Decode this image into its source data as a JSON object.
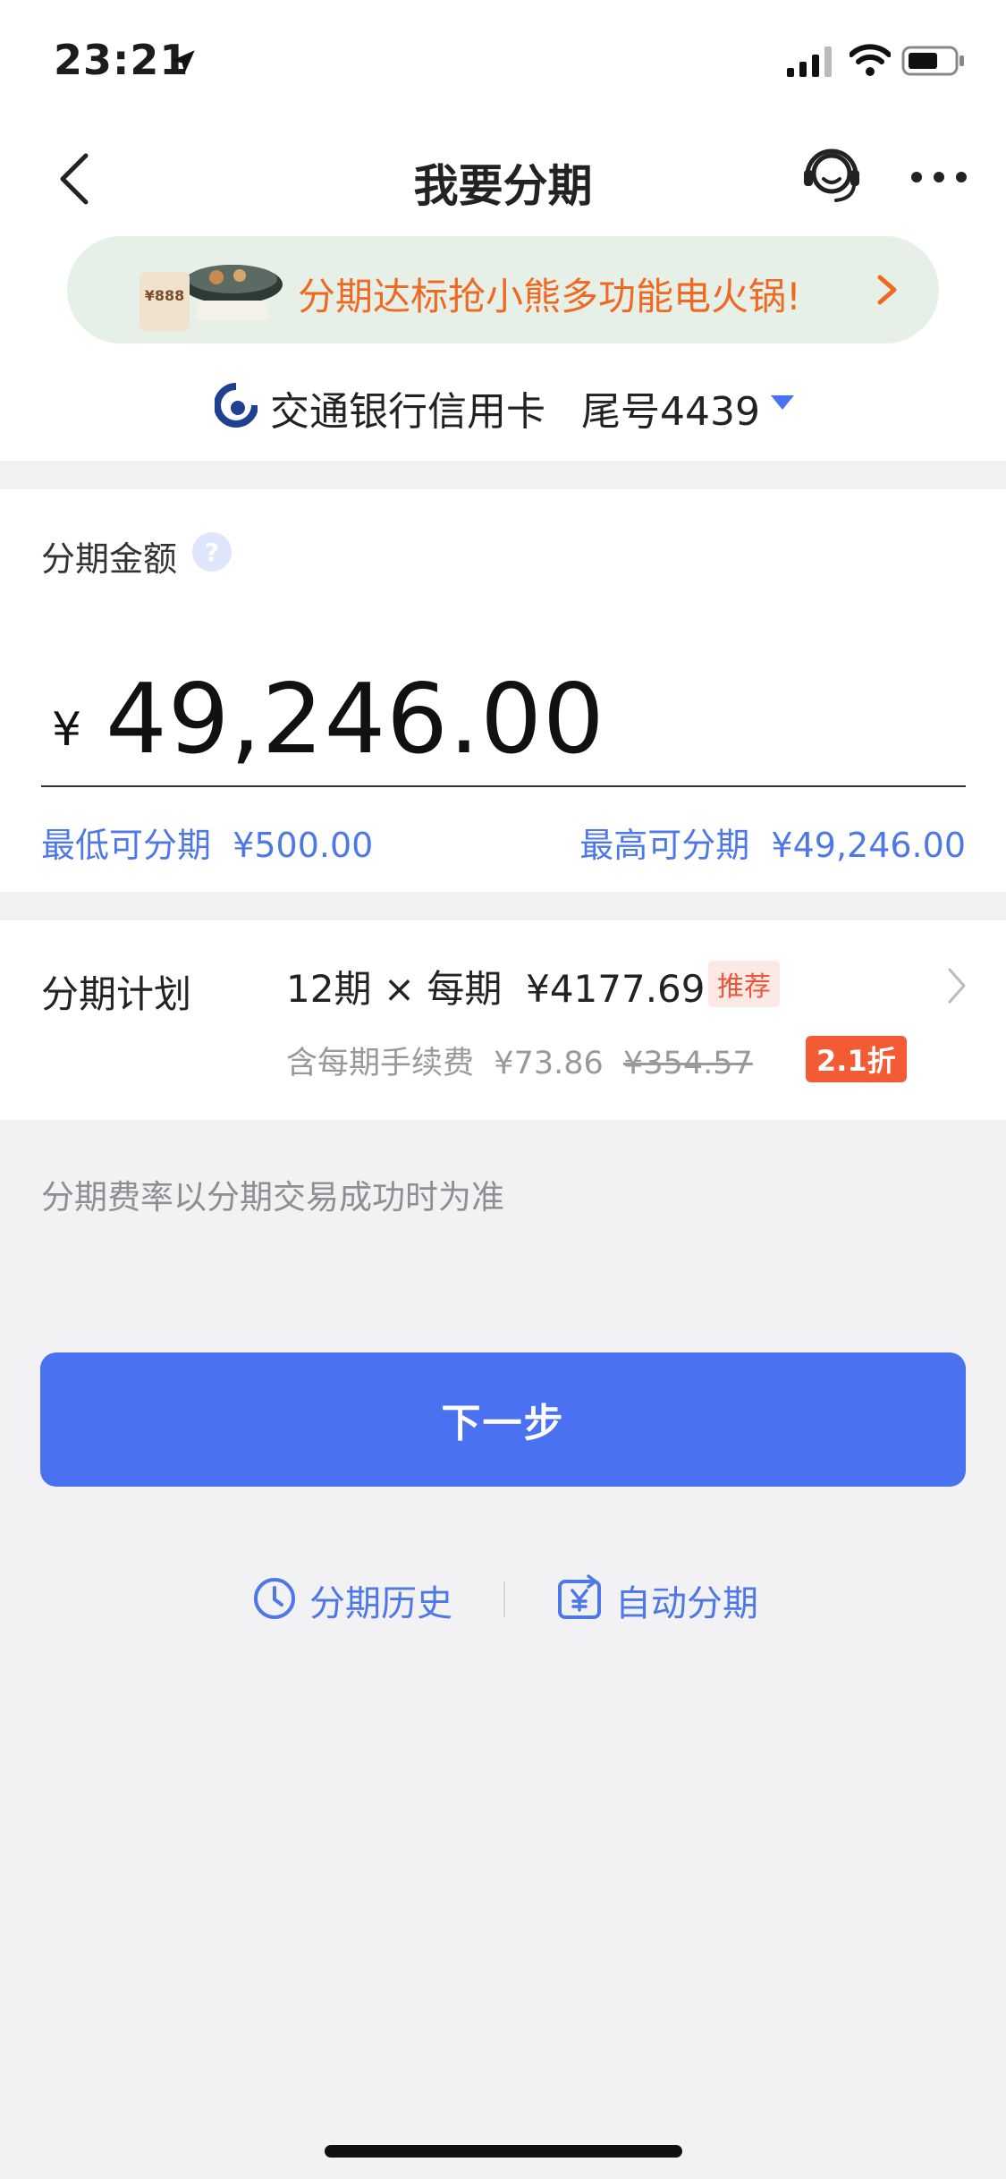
{
  "status_bar": {
    "time": "23:21",
    "icons": [
      "location-arrow-icon",
      "signal-icon",
      "wifi-icon",
      "battery-icon"
    ]
  },
  "nav": {
    "title": "我要分期",
    "icons": [
      "back-icon",
      "customer-service-icon",
      "more-icon"
    ]
  },
  "banner": {
    "text": "分期达标抢小熊多功能电火锅!",
    "image_tag": "¥888"
  },
  "card": {
    "bank_name": "交通银行信用卡",
    "tail": "尾号4439"
  },
  "amount": {
    "label": "分期金额",
    "currency": "¥",
    "value": "49,246.00",
    "min_label": "最低可分期",
    "min_value": "¥500.00",
    "max_label": "最高可分期",
    "max_value": "¥49,246.00"
  },
  "plan": {
    "label": "分期计划",
    "periods": "12期",
    "times": "×",
    "per_label": "每期",
    "per_amount": "¥4177.69",
    "recommend": "推荐",
    "fee_label": "含每期手续费",
    "fee_value": "¥73.86",
    "fee_original": "¥354.57",
    "discount": "2.1折"
  },
  "note": "分期费率以分期交易成功时为准",
  "next_button": "下一步",
  "links": {
    "history": "分期历史",
    "auto": "自动分期"
  },
  "colors": {
    "primary": "#4a71f0",
    "link": "#4e78e8",
    "banner_text": "#ee6a24",
    "discount": "#f25b34",
    "background": "#f2f2f4"
  }
}
